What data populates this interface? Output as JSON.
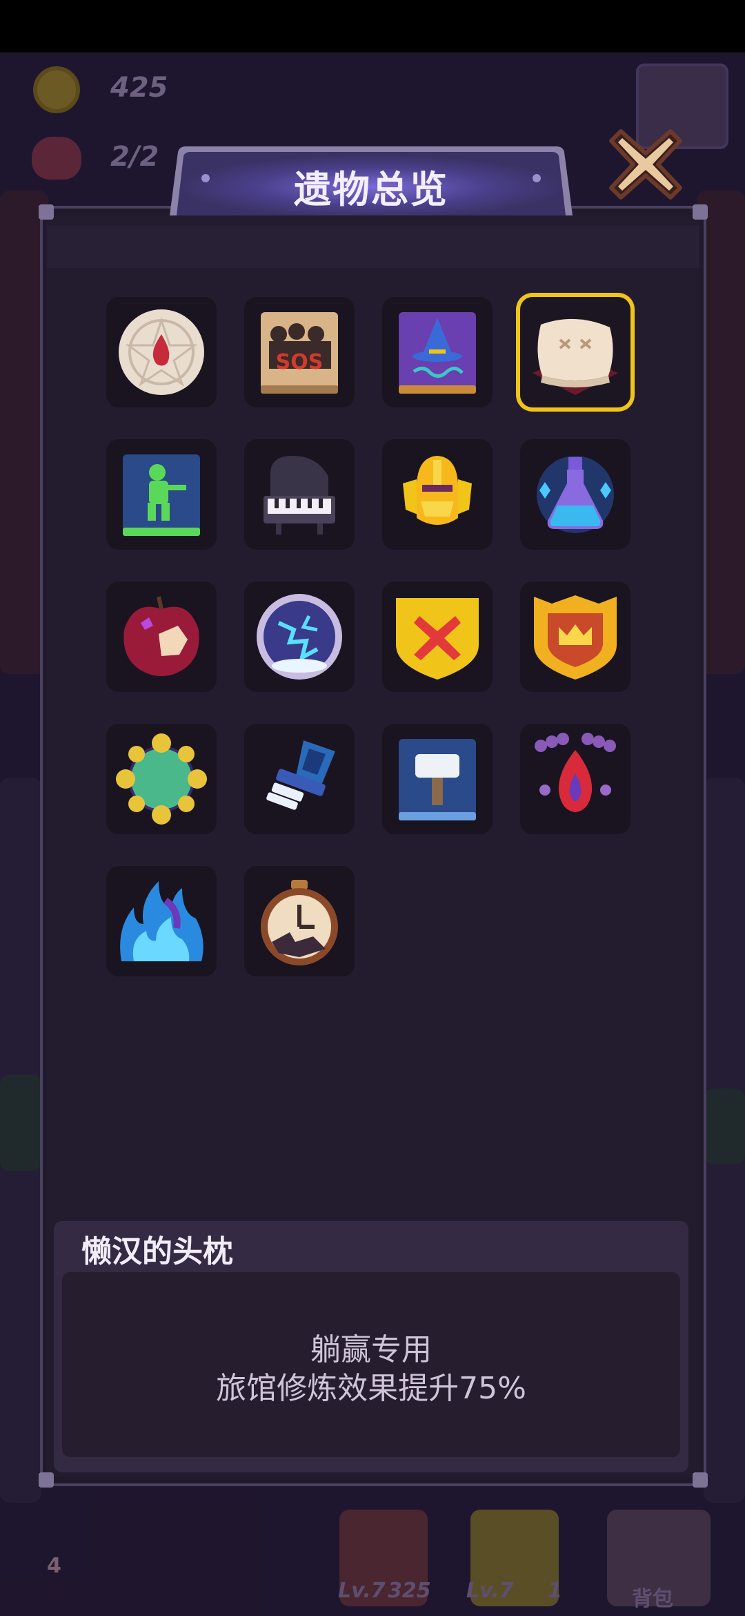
{
  "hud": {
    "gold": "425",
    "count": "2/2"
  },
  "bottom_bar": {
    "card1_level": "Lv.7",
    "card1_value": "325",
    "card2_level": "Lv.7",
    "card2_value": "1",
    "backpack_label": "背包",
    "left_count": "4"
  },
  "dialog": {
    "title": "遗物总览",
    "selected_index": 3,
    "relics": [
      {
        "icon": "pentagram-disc-icon"
      },
      {
        "icon": "record-album-icon",
        "text": "SOS"
      },
      {
        "icon": "wizard-book-icon"
      },
      {
        "icon": "pillow-icon"
      },
      {
        "icon": "army-man-book-icon"
      },
      {
        "icon": "piano-icon"
      },
      {
        "icon": "golden-helmet-icon"
      },
      {
        "icon": "blue-potion-icon"
      },
      {
        "icon": "bitten-apple-icon"
      },
      {
        "icon": "lightning-orb-icon"
      },
      {
        "icon": "red-x-shield-icon"
      },
      {
        "icon": "crown-shield-icon"
      },
      {
        "icon": "spiked-ball-icon"
      },
      {
        "icon": "blue-sword-icon"
      },
      {
        "icon": "hammer-book-icon"
      },
      {
        "icon": "fire-necklace-icon"
      },
      {
        "icon": "blue-flame-icon"
      },
      {
        "icon": "pocket-watch-icon"
      }
    ],
    "detail": {
      "name": "懒汉的头枕",
      "line1": "躺赢专用",
      "line2": "旅馆修炼效果提升75%"
    }
  }
}
